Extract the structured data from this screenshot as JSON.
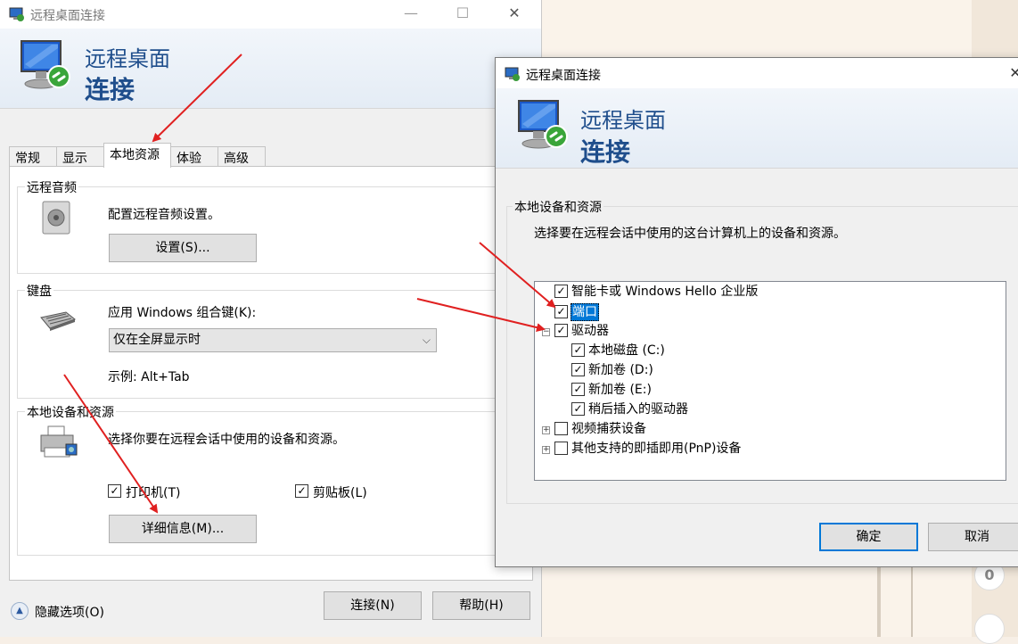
{
  "main_window": {
    "title": "远程桌面连接",
    "banner_line1": "远程桌面",
    "banner_line2": "连接",
    "tabs": [
      {
        "label": "常规"
      },
      {
        "label": "显示"
      },
      {
        "label": "本地资源",
        "active": true
      },
      {
        "label": "体验"
      },
      {
        "label": "高级"
      }
    ],
    "audio": {
      "caption": "远程音频",
      "description": "配置远程音频设置。",
      "button": "设置(S)..."
    },
    "keyboard": {
      "caption": "键盘",
      "label": "应用 Windows 组合键(K):",
      "selected": "仅在全屏显示时",
      "example": "示例: Alt+Tab"
    },
    "local_devices": {
      "caption": "本地设备和资源",
      "description": "选择你要在远程会话中使用的设备和资源。",
      "printer_label": "打印机(T)",
      "printer_checked": true,
      "clipboard_label": "剪贴板(L)",
      "clipboard_checked": true,
      "details_button": "详细信息(M)..."
    },
    "footer": {
      "hide_options": "隐藏选项(O)",
      "connect_button": "连接(N)",
      "help_button": "帮助(H)"
    },
    "icons": {
      "title": "rdp-icon",
      "logo": "monitor-icon",
      "audio": "speaker-icon",
      "keyboard": "keyboard-icon",
      "devices": "printer-icon"
    }
  },
  "popup": {
    "title": "远程桌面连接",
    "banner_line1": "远程桌面",
    "banner_line2": "连接",
    "group_caption": "本地设备和资源",
    "description": "选择要在远程会话中使用的这台计算机上的设备和资源。",
    "tree": [
      {
        "label": "智能卡或 Windows Hello 企业版",
        "checked": true,
        "level": 0
      },
      {
        "label": "端口",
        "checked": true,
        "level": 0,
        "selected": true
      },
      {
        "label": "驱动器",
        "checked": true,
        "level": 0,
        "expander": "−"
      },
      {
        "label": "本地磁盘 (C:)",
        "checked": true,
        "level": 1
      },
      {
        "label": "新加卷 (D:)",
        "checked": true,
        "level": 1
      },
      {
        "label": "新加卷 (E:)",
        "checked": true,
        "level": 1
      },
      {
        "label": "稍后插入的驱动器",
        "checked": true,
        "level": 1
      },
      {
        "label": "视频捕获设备",
        "checked": false,
        "level": 0,
        "expander": "+"
      },
      {
        "label": "其他支持的即插即用(PnP)设备",
        "checked": false,
        "level": 0,
        "expander": "+"
      }
    ],
    "ok_button": "确定",
    "cancel_button": "取消"
  },
  "background": {
    "badge": "0"
  },
  "colors": {
    "accent": "#0078d7",
    "banner_text": "#1f4e8c",
    "annotation_arrow": "#e02020"
  }
}
